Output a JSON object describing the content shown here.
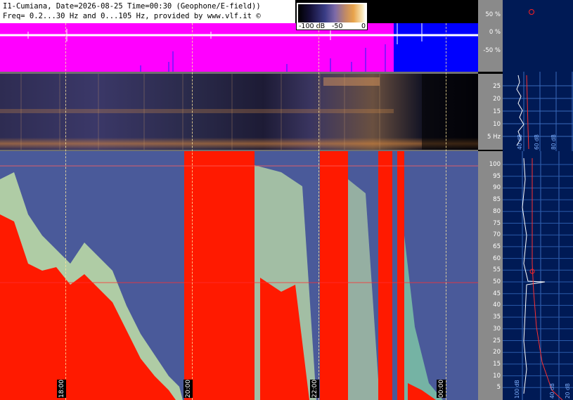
{
  "header": {
    "line1": "I1-Cumiana, Date=2026-08-25 Time=00:30 (Geophone/E-field))",
    "line2": "Freq= 0.2...30 Hz and 0...105 Hz, provided by www.vlf.it ©"
  },
  "colorbar": {
    "labels": [
      "-100 dB",
      "-50",
      "0"
    ]
  },
  "amplitude_axis": {
    "ticks": [
      "50 %",
      "0 %",
      "-50 %"
    ]
  },
  "low_freq_axis": {
    "ticks": [
      "25",
      "20",
      "15",
      "10",
      "5 Hz"
    ]
  },
  "high_freq_axis": {
    "ticks": [
      "100",
      "95",
      "90",
      "85",
      "80",
      "75",
      "70",
      "65",
      "60",
      "55",
      "50",
      "45",
      "40",
      "35",
      "30",
      "25",
      "20",
      "15",
      "10",
      "5"
    ]
  },
  "time_labels": [
    "18:00",
    "20:00",
    "22:00",
    "00:00"
  ],
  "side_low_labels": [
    "40 dB",
    "60 dB",
    "80 dB"
  ],
  "side_high_labels": [
    "40 dB",
    "20 dB"
  ],
  "side_high_first_label": "100 dB",
  "colors": {
    "amplitude_bg": "#ff00ff",
    "amplitude_active": "#0000ff",
    "saturated": "#ff1a00",
    "side_bg": "#001a55",
    "axis_bg": "#8a8a8a"
  }
}
